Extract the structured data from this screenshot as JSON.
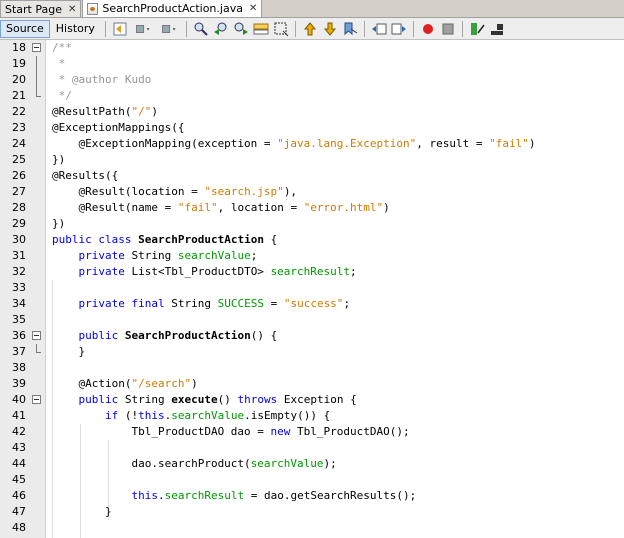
{
  "tabs": [
    {
      "label": "Start Page",
      "active": false,
      "closable": true
    },
    {
      "label": "SearchProductAction.java",
      "active": true,
      "closable": true
    }
  ],
  "toolbar": {
    "source_label": "Source",
    "history_label": "History",
    "icons": [
      "last-edit-icon",
      "back-icon",
      "forward-icon",
      "find-icon",
      "find-previous-icon",
      "find-next-icon",
      "find-selection-icon",
      "toggle-highlight-icon",
      "toggle-rectangular-icon",
      "previous-bookmark-icon",
      "next-bookmark-icon",
      "toggle-bookmark-icon",
      "shift-left-icon",
      "shift-right-icon",
      "record-macro-icon",
      "stop-macro-icon",
      "comment-icon",
      "uncomment-icon"
    ]
  },
  "colors": {
    "keyword": "#0000e6",
    "string": "#ce7b00",
    "comment": "#969696",
    "field": "#009900"
  },
  "code_lines": [
    {
      "n": "18",
      "text": "/**"
    },
    {
      "n": "19",
      "text": " *"
    },
    {
      "n": "20",
      "text": " * @author Kudo"
    },
    {
      "n": "21",
      "text": " */"
    },
    {
      "n": "22",
      "text": "@ResultPath(\"/\")"
    },
    {
      "n": "23",
      "text": "@ExceptionMappings({"
    },
    {
      "n": "24",
      "text": "    @ExceptionMapping(exception = \"java.lang.Exception\", result = \"fail\")"
    },
    {
      "n": "25",
      "text": "})"
    },
    {
      "n": "26",
      "text": "@Results({"
    },
    {
      "n": "27",
      "text": "    @Result(location = \"search.jsp\"),"
    },
    {
      "n": "28",
      "text": "    @Result(name = \"fail\", location = \"error.html\")"
    },
    {
      "n": "29",
      "text": "})"
    },
    {
      "n": "30",
      "text": "public class SearchProductAction {"
    },
    {
      "n": "31",
      "text": "    private String searchValue;"
    },
    {
      "n": "32",
      "text": "    private List<Tbl_ProductDTO> searchResult;"
    },
    {
      "n": "33",
      "text": ""
    },
    {
      "n": "34",
      "text": "    private final String SUCCESS = \"success\";"
    },
    {
      "n": "35",
      "text": ""
    },
    {
      "n": "36",
      "text": "    public SearchProductAction() {"
    },
    {
      "n": "37",
      "text": "    }"
    },
    {
      "n": "38",
      "text": ""
    },
    {
      "n": "39",
      "text": "    @Action(\"/search\")"
    },
    {
      "n": "40",
      "text": "    public String execute() throws Exception {"
    },
    {
      "n": "41",
      "text": "        if (!this.searchValue.isEmpty()) {"
    },
    {
      "n": "42",
      "text": "            Tbl_ProductDAO dao = new Tbl_ProductDAO();"
    },
    {
      "n": "43",
      "text": ""
    },
    {
      "n": "44",
      "text": "            dao.searchProduct(searchValue);"
    },
    {
      "n": "45",
      "text": ""
    },
    {
      "n": "46",
      "text": "            this.searchResult = dao.getSearchResults();"
    },
    {
      "n": "47",
      "text": "        }"
    },
    {
      "n": "48",
      "text": ""
    }
  ]
}
